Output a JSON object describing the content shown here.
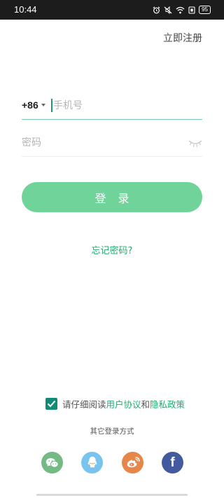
{
  "status_bar": {
    "time": "10:44",
    "battery": "95",
    "icons": [
      "alarm-icon",
      "mute-icon",
      "wifi-icon",
      "sim-icon",
      "battery-icon"
    ]
  },
  "header": {
    "register_label": "立即注册"
  },
  "login_form": {
    "country_code": "+86",
    "phone_placeholder": "手机号",
    "phone_value": "",
    "password_placeholder": "密码",
    "password_value": "",
    "login_button": "登 录",
    "forgot_link": "忘记密码?"
  },
  "agreement": {
    "checked": true,
    "prefix": "请仔细阅读",
    "user_agreement": "用户协议",
    "connector": "和",
    "privacy_policy": "隐私政策"
  },
  "other_login": {
    "title": "其它登录方式",
    "providers": [
      "wechat-icon",
      "qq-icon",
      "weibo-icon",
      "facebook-icon"
    ],
    "facebook_glyph": "f"
  },
  "colors": {
    "accent": "#1fae70",
    "button": "#6fd39a",
    "checkbox": "#138a76",
    "status_bar": "#1c1c1c",
    "wechat": "#74ba84",
    "qq": "#79c4ef",
    "weibo": "#e6864a",
    "facebook": "#445a9e"
  }
}
